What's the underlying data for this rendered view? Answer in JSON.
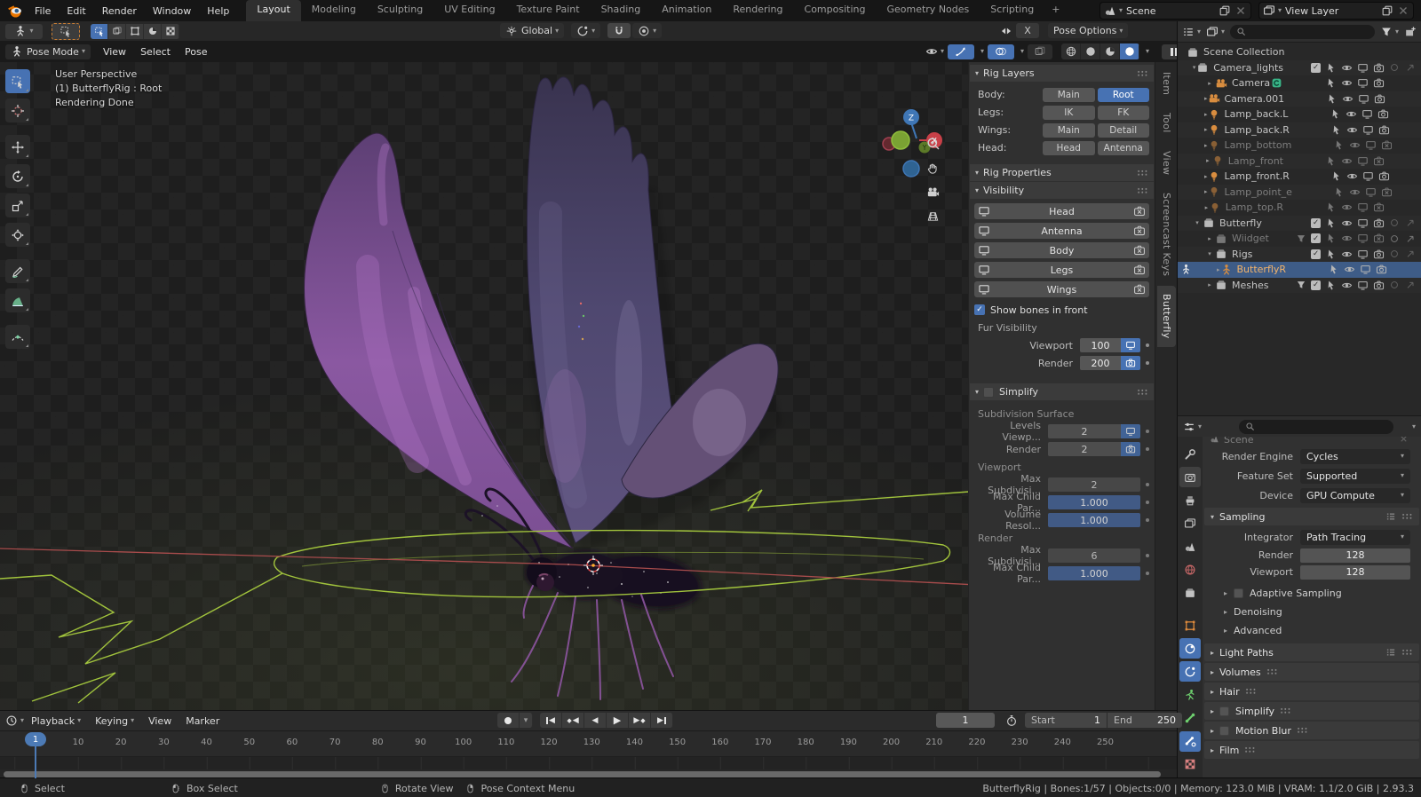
{
  "topbar": {
    "menus": [
      "File",
      "Edit",
      "Render",
      "Window",
      "Help"
    ],
    "tabs": [
      {
        "label": "Layout",
        "cls": "on"
      },
      {
        "label": "Modeling",
        "cls": ""
      },
      {
        "label": "Sculpting",
        "cls": ""
      },
      {
        "label": "UV Editing",
        "cls": ""
      },
      {
        "label": "Texture Paint",
        "cls": ""
      },
      {
        "label": "Shading",
        "cls": ""
      },
      {
        "label": "Animation",
        "cls": ""
      },
      {
        "label": "Rendering",
        "cls": ""
      },
      {
        "label": "Compositing",
        "cls": ""
      },
      {
        "label": "Geometry Nodes",
        "cls": ""
      },
      {
        "label": "Scripting",
        "cls": ""
      },
      {
        "label": "+",
        "cls": "plus"
      }
    ],
    "scene": {
      "label": "Scene"
    },
    "view_layer": {
      "label": "View Layer"
    }
  },
  "tool_settings": {
    "orientation": "Global",
    "mirror_label": "X",
    "pose_options": "Pose Options"
  },
  "viewport": {
    "mode": "Pose Mode",
    "menus": [
      "View",
      "Select",
      "Pose"
    ],
    "overlay_lines": [
      "User Perspective",
      "(1) ButterflyRig : Root",
      "Rendering Done"
    ],
    "toolbar": [
      {
        "icon": "tb-select",
        "cls": "active"
      },
      {
        "icon": "tb-cursor",
        "cls": ""
      },
      {
        "icon": "tb-move",
        "cls": "gap"
      },
      {
        "icon": "tb-rotate",
        "cls": ""
      },
      {
        "icon": "tb-scale",
        "cls": ""
      },
      {
        "icon": "tb-transform",
        "cls": ""
      },
      {
        "icon": "tb-annotate",
        "cls": "gap"
      },
      {
        "icon": "tb-measure",
        "cls": ""
      },
      {
        "icon": "tb-breakdown",
        "cls": "gap"
      }
    ],
    "gizmo_axes": [
      "Z",
      "Y",
      "X"
    ]
  },
  "sidebar_tabs": [
    {
      "label": "Item",
      "cls": ""
    },
    {
      "label": "Tool",
      "cls": ""
    },
    {
      "label": "View",
      "cls": ""
    },
    {
      "label": "Screencast Keys",
      "cls": ""
    },
    {
      "label": "Butterfly",
      "cls": "active"
    }
  ],
  "n_panel": {
    "rig_layers": {
      "title": "Rig Layers",
      "rows": [
        {
          "label": "Body:",
          "b1": "Main",
          "b1cls": "",
          "b2": "Root",
          "b2cls": "blue"
        },
        {
          "label": "Legs:",
          "b1": "IK",
          "b1cls": "",
          "b2": "FK",
          "b2cls": ""
        },
        {
          "label": "Wings:",
          "b1": "Main",
          "b1cls": "",
          "b2": "Detail",
          "b2cls": ""
        },
        {
          "label": "Head:",
          "b1": "Head",
          "b1cls": "",
          "b2": "Antenna",
          "b2cls": ""
        }
      ]
    },
    "rig_properties": {
      "title": "Rig Properties"
    },
    "visibility": {
      "title": "Visibility",
      "buttons": [
        {
          "label": "Head"
        },
        {
          "label": "Antenna"
        },
        {
          "label": "Body"
        },
        {
          "label": "Legs"
        },
        {
          "label": "Wings"
        }
      ],
      "show_bones": "Show bones in front",
      "fur_title": "Fur Visibility",
      "viewport_label": "Viewport",
      "viewport_value": "100",
      "render_label": "Render",
      "render_value": "200"
    },
    "simplify": {
      "title": "Simplify",
      "subdiv_title": "Subdivision Surface",
      "rows1": [
        {
          "label": "Levels Viewp...",
          "value": "2",
          "icon": "monitor"
        },
        {
          "label": "Render",
          "value": "2",
          "icon": "camera"
        }
      ],
      "viewport_title": "Viewport",
      "rows2": [
        {
          "label": "Max Subdivisi...",
          "value": "2",
          "cls": ""
        },
        {
          "label": "Max Child Par...",
          "value": "1.000",
          "cls": "slider"
        },
        {
          "label": "Volume Resol...",
          "value": "1.000",
          "cls": "slider"
        }
      ],
      "render_title": "Render",
      "rows3": [
        {
          "label": "Max Subdivisi...",
          "value": "6",
          "cls": ""
        },
        {
          "label": "Max Child Par...",
          "value": "1.000",
          "cls": "slider"
        }
      ]
    }
  },
  "outliner": {
    "rows": [
      {
        "cls": "d0",
        "exp": "",
        "icon": "box",
        "label": "Scene Collection"
      },
      {
        "cls": "d1",
        "exp": "▾",
        "icon": "box",
        "label": "Camera_lights",
        "cb": true,
        "tp": "pointer",
        "te": "eye",
        "tm": "monitor",
        "tc": "camera",
        "extras": true
      },
      {
        "cls": "d2",
        "exp": "▸",
        "icon": "camdata",
        "iconcls": "org",
        "label": "Camera",
        "badge": "ovr",
        "tp": "pointer",
        "te": "eye",
        "tm": "monitor",
        "tc": "camera"
      },
      {
        "cls": "d2",
        "exp": "▸",
        "icon": "camdata",
        "iconcls": "org",
        "label": "Camera.001",
        "tp": "pointer",
        "te": "eye",
        "tm": "monitor",
        "tc": "camera"
      },
      {
        "cls": "d2",
        "exp": "▸",
        "icon": "bulb",
        "iconcls": "org",
        "label": "Lamp_back.L",
        "tp": "pointer",
        "te": "eye",
        "tm": "monitor",
        "tc": "camera"
      },
      {
        "cls": "d2",
        "exp": "▸",
        "icon": "bulb",
        "iconcls": "org",
        "label": "Lamp_back.R",
        "tp": "pointer",
        "te": "eye",
        "tm": "monitor",
        "tc": "camera"
      },
      {
        "cls": "d2 dim",
        "exp": "▸",
        "icon": "bulb",
        "iconcls": "org",
        "label": "Lamp_bottom",
        "tp": "pointer",
        "te": "eye",
        "tm": "monitor",
        "tc": "camera-x"
      },
      {
        "cls": "d2 dim",
        "exp": "▸",
        "icon": "bulb",
        "iconcls": "org",
        "label": "Lamp_front",
        "tp": "pointer",
        "te": "eye",
        "tm": "monitor",
        "tc": "camera-x"
      },
      {
        "cls": "d2",
        "exp": "▸",
        "icon": "bulb",
        "iconcls": "org",
        "label": "Lamp_front.R",
        "tp": "pointer",
        "te": "eye",
        "tm": "monitor",
        "tc": "camera"
      },
      {
        "cls": "d2 dim",
        "exp": "▸",
        "icon": "bulb",
        "iconcls": "org",
        "label": "Lamp_point_e",
        "tp": "pointer",
        "te": "eye",
        "tm": "monitor",
        "tc": "camera-x"
      },
      {
        "cls": "d2 dim",
        "exp": "▸",
        "icon": "bulb",
        "iconcls": "org",
        "label": "Lamp_top.R",
        "tp": "pointer",
        "te": "eye",
        "tm": "monitor",
        "tc": "camera-x"
      },
      {
        "cls": "d1",
        "exp": "▾",
        "icon": "box",
        "label": "Butterfly",
        "cb": true,
        "tp": "pointer",
        "te": "eye",
        "tm": "monitor",
        "tc": "camera",
        "extras": true
      },
      {
        "cls": "d2 dim",
        "exp": "▸",
        "icon": "box",
        "label": "Wiidget",
        "pre": "funnel",
        "cb": true,
        "tp": "pointer",
        "te": "eye",
        "tm": "monitor",
        "tc": "camera-x",
        "extras": true
      },
      {
        "cls": "d2",
        "exp": "▾",
        "icon": "box",
        "label": "Rigs",
        "cb": true,
        "tp": "pointer",
        "te": "eye",
        "tm": "monitor",
        "tc": "camera",
        "extras": true
      },
      {
        "cls": "d3 selected",
        "exp": "▸",
        "icon": "armature",
        "iconcls": "org",
        "label": "ButterflyR",
        "lcls": "warm",
        "mode": true,
        "tp": "pointer",
        "te": "eye",
        "tm": "monitor",
        "tc": "camera"
      },
      {
        "cls": "d2",
        "exp": "▸",
        "icon": "box",
        "label": "Meshes",
        "pre": "funnel",
        "cb": true,
        "tp": "pointer",
        "te": "eye",
        "tm": "monitor",
        "tc": "camera",
        "extras": true
      }
    ]
  },
  "properties": {
    "breadcrumb": "Scene",
    "render_engine_label": "Render Engine",
    "render_engine": "Cycles",
    "feature_set_label": "Feature Set",
    "feature_set": "Supported",
    "device_label": "Device",
    "device": "GPU Compute",
    "sampling_title": "Sampling",
    "integrator_label": "Integrator",
    "integrator": "Path Tracing",
    "render_label": "Render",
    "render_value": "128",
    "viewport_label": "Viewport",
    "viewport_value": "128",
    "sub_panels": [
      {
        "label": "Adaptive Sampling",
        "cb": true
      },
      {
        "label": "Denoising"
      },
      {
        "label": "Advanced"
      }
    ],
    "panels": [
      {
        "label": "Light Paths",
        "presets": true
      },
      {
        "label": "Volumes"
      },
      {
        "label": "Hair"
      },
      {
        "label": "Simplify",
        "cb": true
      },
      {
        "label": "Motion Blur",
        "cb": true
      },
      {
        "label": "Film"
      }
    ],
    "tabs": [
      {
        "icon": "wrench",
        "cls": ""
      },
      {
        "icon": "camback",
        "cls": "active"
      },
      {
        "icon": "printer",
        "cls": ""
      },
      {
        "icon": "photos",
        "cls": ""
      },
      {
        "icon": "scene",
        "cls": ""
      },
      {
        "icon": "world",
        "cls": "red"
      },
      {
        "icon": "box",
        "cls": ""
      },
      {
        "icon": "objsq",
        "cls": "orange mt"
      },
      {
        "icon": "constraint",
        "cls": "blue"
      },
      {
        "icon": "physics",
        "cls": "blue"
      },
      {
        "icon": "runman",
        "cls": "green"
      },
      {
        "icon": "bone",
        "cls": "green"
      },
      {
        "icon": "bonec",
        "cls": "blue"
      },
      {
        "icon": "checker",
        "cls": "pink"
      }
    ]
  },
  "timeline": {
    "menus": [
      {
        "label": "Playback",
        "dd": true
      },
      {
        "label": "Keying",
        "dd": true
      },
      {
        "label": "View"
      },
      {
        "label": "Marker"
      }
    ],
    "current_frame": "1",
    "start_label": "Start",
    "start_value": "1",
    "end_label": "End",
    "end_value": "250",
    "ruler": [
      "10",
      "20",
      "30",
      "40",
      "50",
      "60",
      "70",
      "80",
      "90",
      "100",
      "110",
      "120",
      "130",
      "140",
      "150",
      "160",
      "170",
      "180",
      "190",
      "200",
      "210",
      "220",
      "230",
      "240",
      "250"
    ]
  },
  "status_bar": {
    "hints": [
      {
        "mouse": "m-left",
        "label": "Select"
      },
      {
        "mouse": "m-drag",
        "label": "Box Select"
      },
      {
        "mouse": "m-middle",
        "label": "Rotate View"
      },
      {
        "mouse": "m-right",
        "label": "Pose Context Menu"
      }
    ],
    "info": "ButterflyRig | Bones:1/57 | Objects:0/0 | Memory: 123.0 MiB | VRAM: 1.1/2.0 GiB | 2.93.3"
  },
  "colors": {
    "accent": "#4772b3",
    "selected_row": "#3e5c87",
    "bone_selected_green": "#a8cc3e",
    "relationship_line_red": "#a84c4c",
    "data_icon_orange": "#d98d3f"
  }
}
